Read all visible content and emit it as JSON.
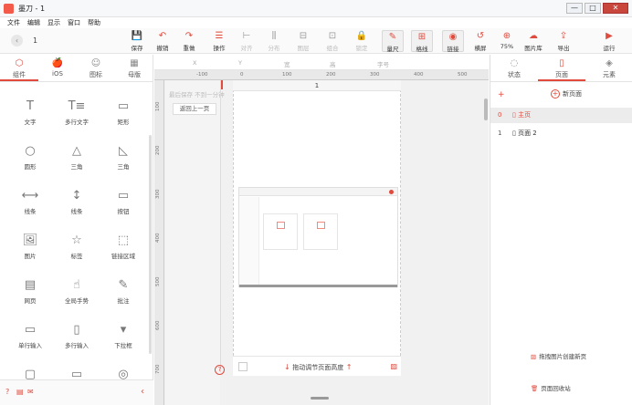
{
  "window": {
    "title": "墨刀 - 1",
    "controls": [
      "—",
      "□",
      "✕"
    ]
  },
  "menubar": [
    "文件",
    "编辑",
    "显示",
    "窗口",
    "帮助"
  ],
  "toolbar": {
    "page_number": "1",
    "tools": [
      {
        "label": "保存",
        "icon": "save-icon",
        "glyph": "💾"
      },
      {
        "label": "撤销",
        "icon": "undo-icon",
        "glyph": "↶"
      },
      {
        "label": "重做",
        "icon": "redo-icon",
        "glyph": "↷"
      },
      {
        "label": "操作",
        "icon": "operation-icon",
        "glyph": "☰"
      },
      {
        "label": "对齐",
        "icon": "align-icon",
        "glyph": "⊢"
      },
      {
        "label": "分布",
        "icon": "distribute-icon",
        "glyph": "⫼"
      },
      {
        "label": "图层",
        "icon": "layer-icon",
        "glyph": "⊟"
      },
      {
        "label": "组合",
        "icon": "group-icon",
        "glyph": "⊡"
      },
      {
        "label": "锁定",
        "icon": "lock-icon",
        "glyph": "🔒"
      },
      {
        "label": "量尺",
        "icon": "ruler-icon",
        "glyph": "✎"
      },
      {
        "label": "格线",
        "icon": "grid-icon",
        "glyph": "⊞"
      },
      {
        "label": "链接",
        "icon": "link-eye-icon",
        "glyph": "◉"
      },
      {
        "label": "横屏",
        "icon": "rotate-icon",
        "glyph": "↺"
      },
      {
        "label": "75%",
        "icon": "zoom-icon",
        "glyph": "⊕"
      },
      {
        "label": "图片库",
        "icon": "image-library-icon",
        "glyph": "☁"
      },
      {
        "label": "导出",
        "icon": "export-icon",
        "glyph": "⇪"
      },
      {
        "label": "运行",
        "icon": "run-icon",
        "glyph": "▶"
      }
    ]
  },
  "left_panel": {
    "tabs": [
      {
        "label": "组件",
        "icon": "component-icon",
        "glyph": "⬡"
      },
      {
        "label": "iOS",
        "icon": "apple-icon",
        "glyph": "🍎"
      },
      {
        "label": "图标",
        "icon": "emoji-icon",
        "glyph": "☺"
      },
      {
        "label": "母版",
        "icon": "master-icon",
        "glyph": "▦"
      }
    ],
    "components": [
      {
        "label": "文字",
        "icon": "text-icon",
        "glyph": "T"
      },
      {
        "label": "多行文字",
        "icon": "multiline-text-icon",
        "glyph": "T≡"
      },
      {
        "label": "矩形",
        "icon": "rectangle-icon",
        "glyph": "▭"
      },
      {
        "label": "圆形",
        "icon": "circle-icon",
        "glyph": "○"
      },
      {
        "label": "三角",
        "icon": "triangle-icon",
        "glyph": "△"
      },
      {
        "label": "三角",
        "icon": "right-triangle-icon",
        "glyph": "◺"
      },
      {
        "label": "线条",
        "icon": "hline-icon",
        "glyph": "⟷"
      },
      {
        "label": "线条",
        "icon": "vline-icon",
        "glyph": "↕"
      },
      {
        "label": "按钮",
        "icon": "button-icon",
        "glyph": "▭"
      },
      {
        "label": "图片",
        "icon": "image-icon",
        "glyph": "🖼"
      },
      {
        "label": "标签",
        "icon": "tag-icon",
        "glyph": "☆"
      },
      {
        "label": "链接区域",
        "icon": "link-area-icon",
        "glyph": "⬚"
      },
      {
        "label": "网页",
        "icon": "webpage-icon",
        "glyph": "▤"
      },
      {
        "label": "全局手势",
        "icon": "gesture-icon",
        "glyph": "☝"
      },
      {
        "label": "批注",
        "icon": "comment-icon",
        "glyph": "✎"
      },
      {
        "label": "单行输入",
        "icon": "single-input-icon",
        "glyph": "▭"
      },
      {
        "label": "多行输入",
        "icon": "multi-input-icon",
        "glyph": "▯"
      },
      {
        "label": "下拉框",
        "icon": "dropdown-icon",
        "glyph": "▾"
      },
      {
        "label": "",
        "icon": "folder-icon",
        "glyph": "▢"
      },
      {
        "label": "",
        "icon": "keyboard-icon",
        "glyph": "▭"
      },
      {
        "label": "",
        "icon": "camera-icon",
        "glyph": "◎"
      }
    ],
    "footer": {
      "collapse_glyph": "‹"
    }
  },
  "canvas": {
    "props": [
      "X",
      "Y",
      "宽",
      "高",
      "字号"
    ],
    "ruler_top": [
      "-100",
      "0",
      "100",
      "200",
      "300",
      "400",
      "500"
    ],
    "ruler_left": [
      "100",
      "200",
      "300",
      "400",
      "500",
      "600",
      "700"
    ],
    "save_note": "最后保存 不到一分钟",
    "back_button": "返回上一页",
    "page_header": "1",
    "bottom_hint": "拖动调节页面高度"
  },
  "right_panel": {
    "tabs": [
      {
        "label": "状态",
        "icon": "state-icon",
        "glyph": "◌"
      },
      {
        "label": "页面",
        "icon": "page-icon",
        "glyph": "▯"
      },
      {
        "label": "元素",
        "icon": "element-icon",
        "glyph": "◈"
      }
    ],
    "new_page": "新页面",
    "pages": [
      {
        "index": "0",
        "name": "主页"
      },
      {
        "index": "1",
        "name": "页面 2"
      }
    ],
    "create_from_image": "拖拽图片创建新页",
    "trash": "页面回收站"
  },
  "colors": {
    "accent": "#e04b3e"
  }
}
